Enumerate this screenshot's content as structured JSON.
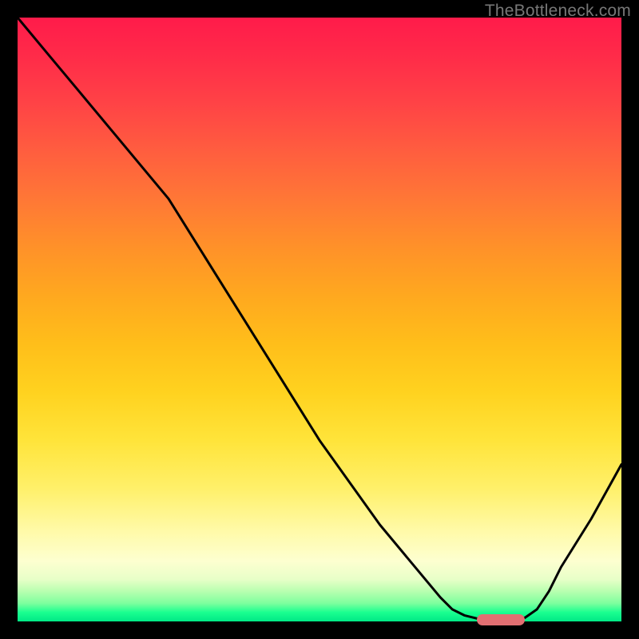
{
  "watermark": "TheBottleneck.com",
  "colors": {
    "frame_bg": "#000000",
    "marker": "#e26f72",
    "curve": "#000000"
  },
  "chart_data": {
    "type": "line",
    "title": "",
    "xlabel": "",
    "ylabel": "",
    "xlim": [
      0,
      100
    ],
    "ylim": [
      0,
      100
    ],
    "x": [
      0,
      5,
      10,
      15,
      20,
      25,
      30,
      35,
      40,
      45,
      50,
      55,
      60,
      65,
      70,
      72,
      74,
      76,
      78,
      80,
      82,
      84,
      86,
      88,
      90,
      95,
      100
    ],
    "y": [
      100,
      94,
      88,
      82,
      76,
      70,
      62,
      54,
      46,
      38,
      30,
      23,
      16,
      10,
      4,
      2,
      1,
      0.5,
      0.3,
      0.2,
      0.3,
      0.6,
      2,
      5,
      9,
      17,
      26
    ],
    "optimum_band": {
      "x_start": 76,
      "x_end": 84,
      "y": 0.3
    },
    "gradient_stops_pct": [
      0,
      6,
      14,
      22,
      30,
      38,
      46,
      54,
      62,
      70,
      78,
      85,
      90,
      93,
      95,
      97,
      98.5,
      100
    ],
    "gradient_colors": [
      "#ff1b4a",
      "#ff2a49",
      "#ff4246",
      "#ff5d3f",
      "#ff7736",
      "#ff9129",
      "#ffa81f",
      "#ffbe1a",
      "#ffd21f",
      "#ffe43a",
      "#fff06a",
      "#fffaa8",
      "#fdffd0",
      "#e8ffc8",
      "#b8ffb0",
      "#7dff9e",
      "#1aff90",
      "#00e886"
    ]
  }
}
